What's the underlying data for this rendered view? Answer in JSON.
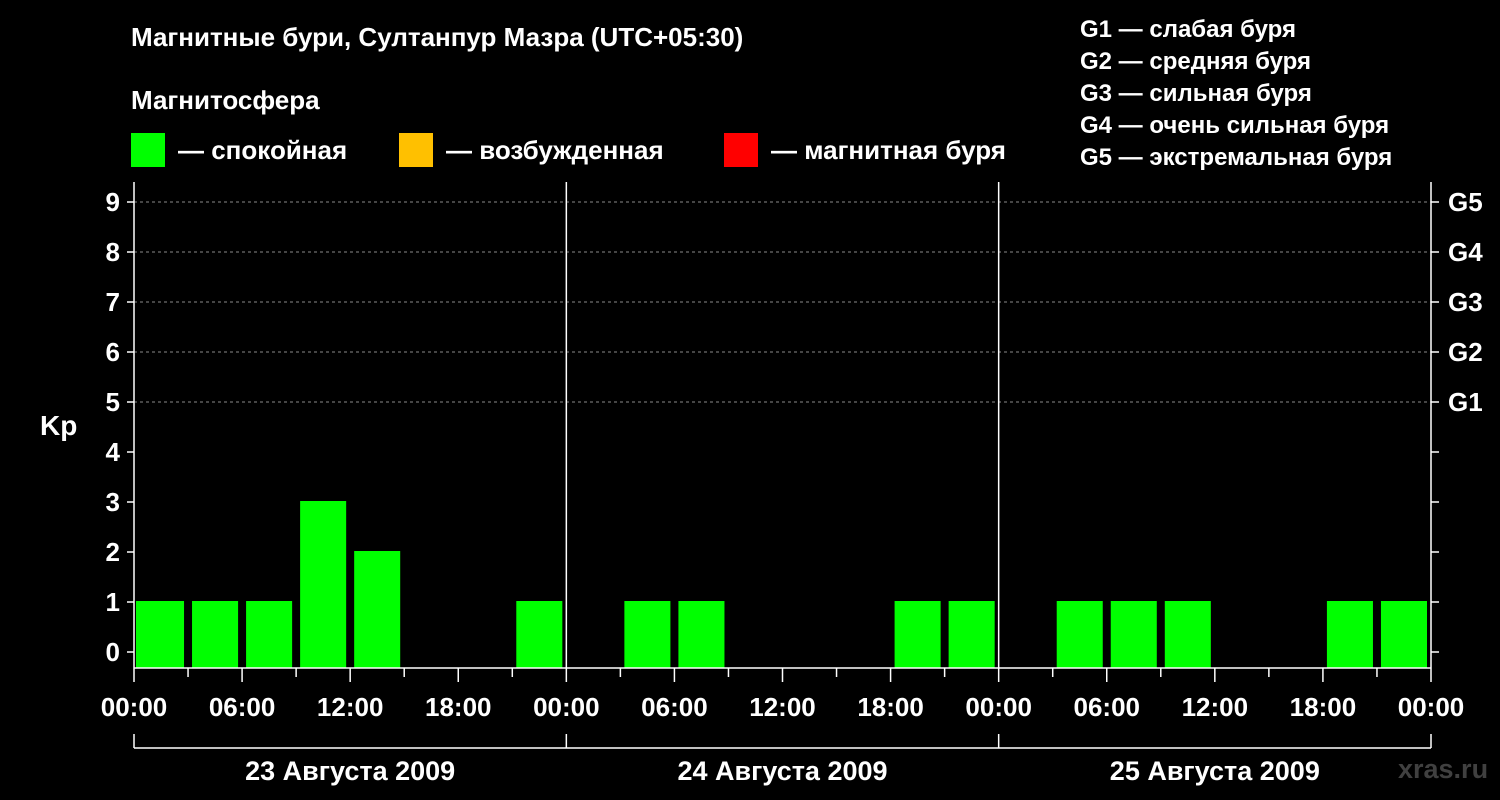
{
  "title": "Магнитные бури, Султанпур Мазра (UTC+05:30)",
  "subtitle": "Магнитосфера",
  "legend": [
    {
      "label": "— спокойная",
      "color": "#00ff00"
    },
    {
      "label": "— возбужденная",
      "color": "#ffc000"
    },
    {
      "label": "— магнитная буря",
      "color": "#ff0000"
    }
  ],
  "g_scale": [
    "G1 — слабая буря",
    "G2 — средняя буря",
    "G3 — сильная буря",
    "G4 — очень сильная буря",
    "G5 — экстремальная буря"
  ],
  "watermark": "xras.ru",
  "chart_data": {
    "type": "bar",
    "ylabel": "Kp",
    "ylim": [
      0,
      9
    ],
    "yticks": [
      0,
      1,
      2,
      3,
      4,
      5,
      6,
      7,
      8,
      9
    ],
    "right_axis_labels": [
      {
        "kp": 5,
        "label": "G1"
      },
      {
        "kp": 6,
        "label": "G2"
      },
      {
        "kp": 7,
        "label": "G3"
      },
      {
        "kp": 8,
        "label": "G4"
      },
      {
        "kp": 9,
        "label": "G5"
      }
    ],
    "grid": "dashed horizontal at Kp 5-9",
    "xtick_labels": [
      "00:00",
      "06:00",
      "12:00",
      "18:00",
      "00:00",
      "06:00",
      "12:00",
      "18:00",
      "00:00",
      "06:00",
      "12:00",
      "18:00",
      "00:00"
    ],
    "days": [
      "23 Августа 2009",
      "24 Августа 2009",
      "25 Августа 2009"
    ],
    "interval_hours": 3,
    "series": [
      {
        "values": [
          1,
          1,
          1,
          3,
          2,
          0,
          0,
          1,
          0,
          1,
          1,
          0,
          0,
          0,
          1,
          1,
          0,
          1,
          1,
          1,
          0,
          0,
          1,
          1
        ]
      }
    ],
    "bar_colors": [
      "#00ff00"
    ]
  }
}
